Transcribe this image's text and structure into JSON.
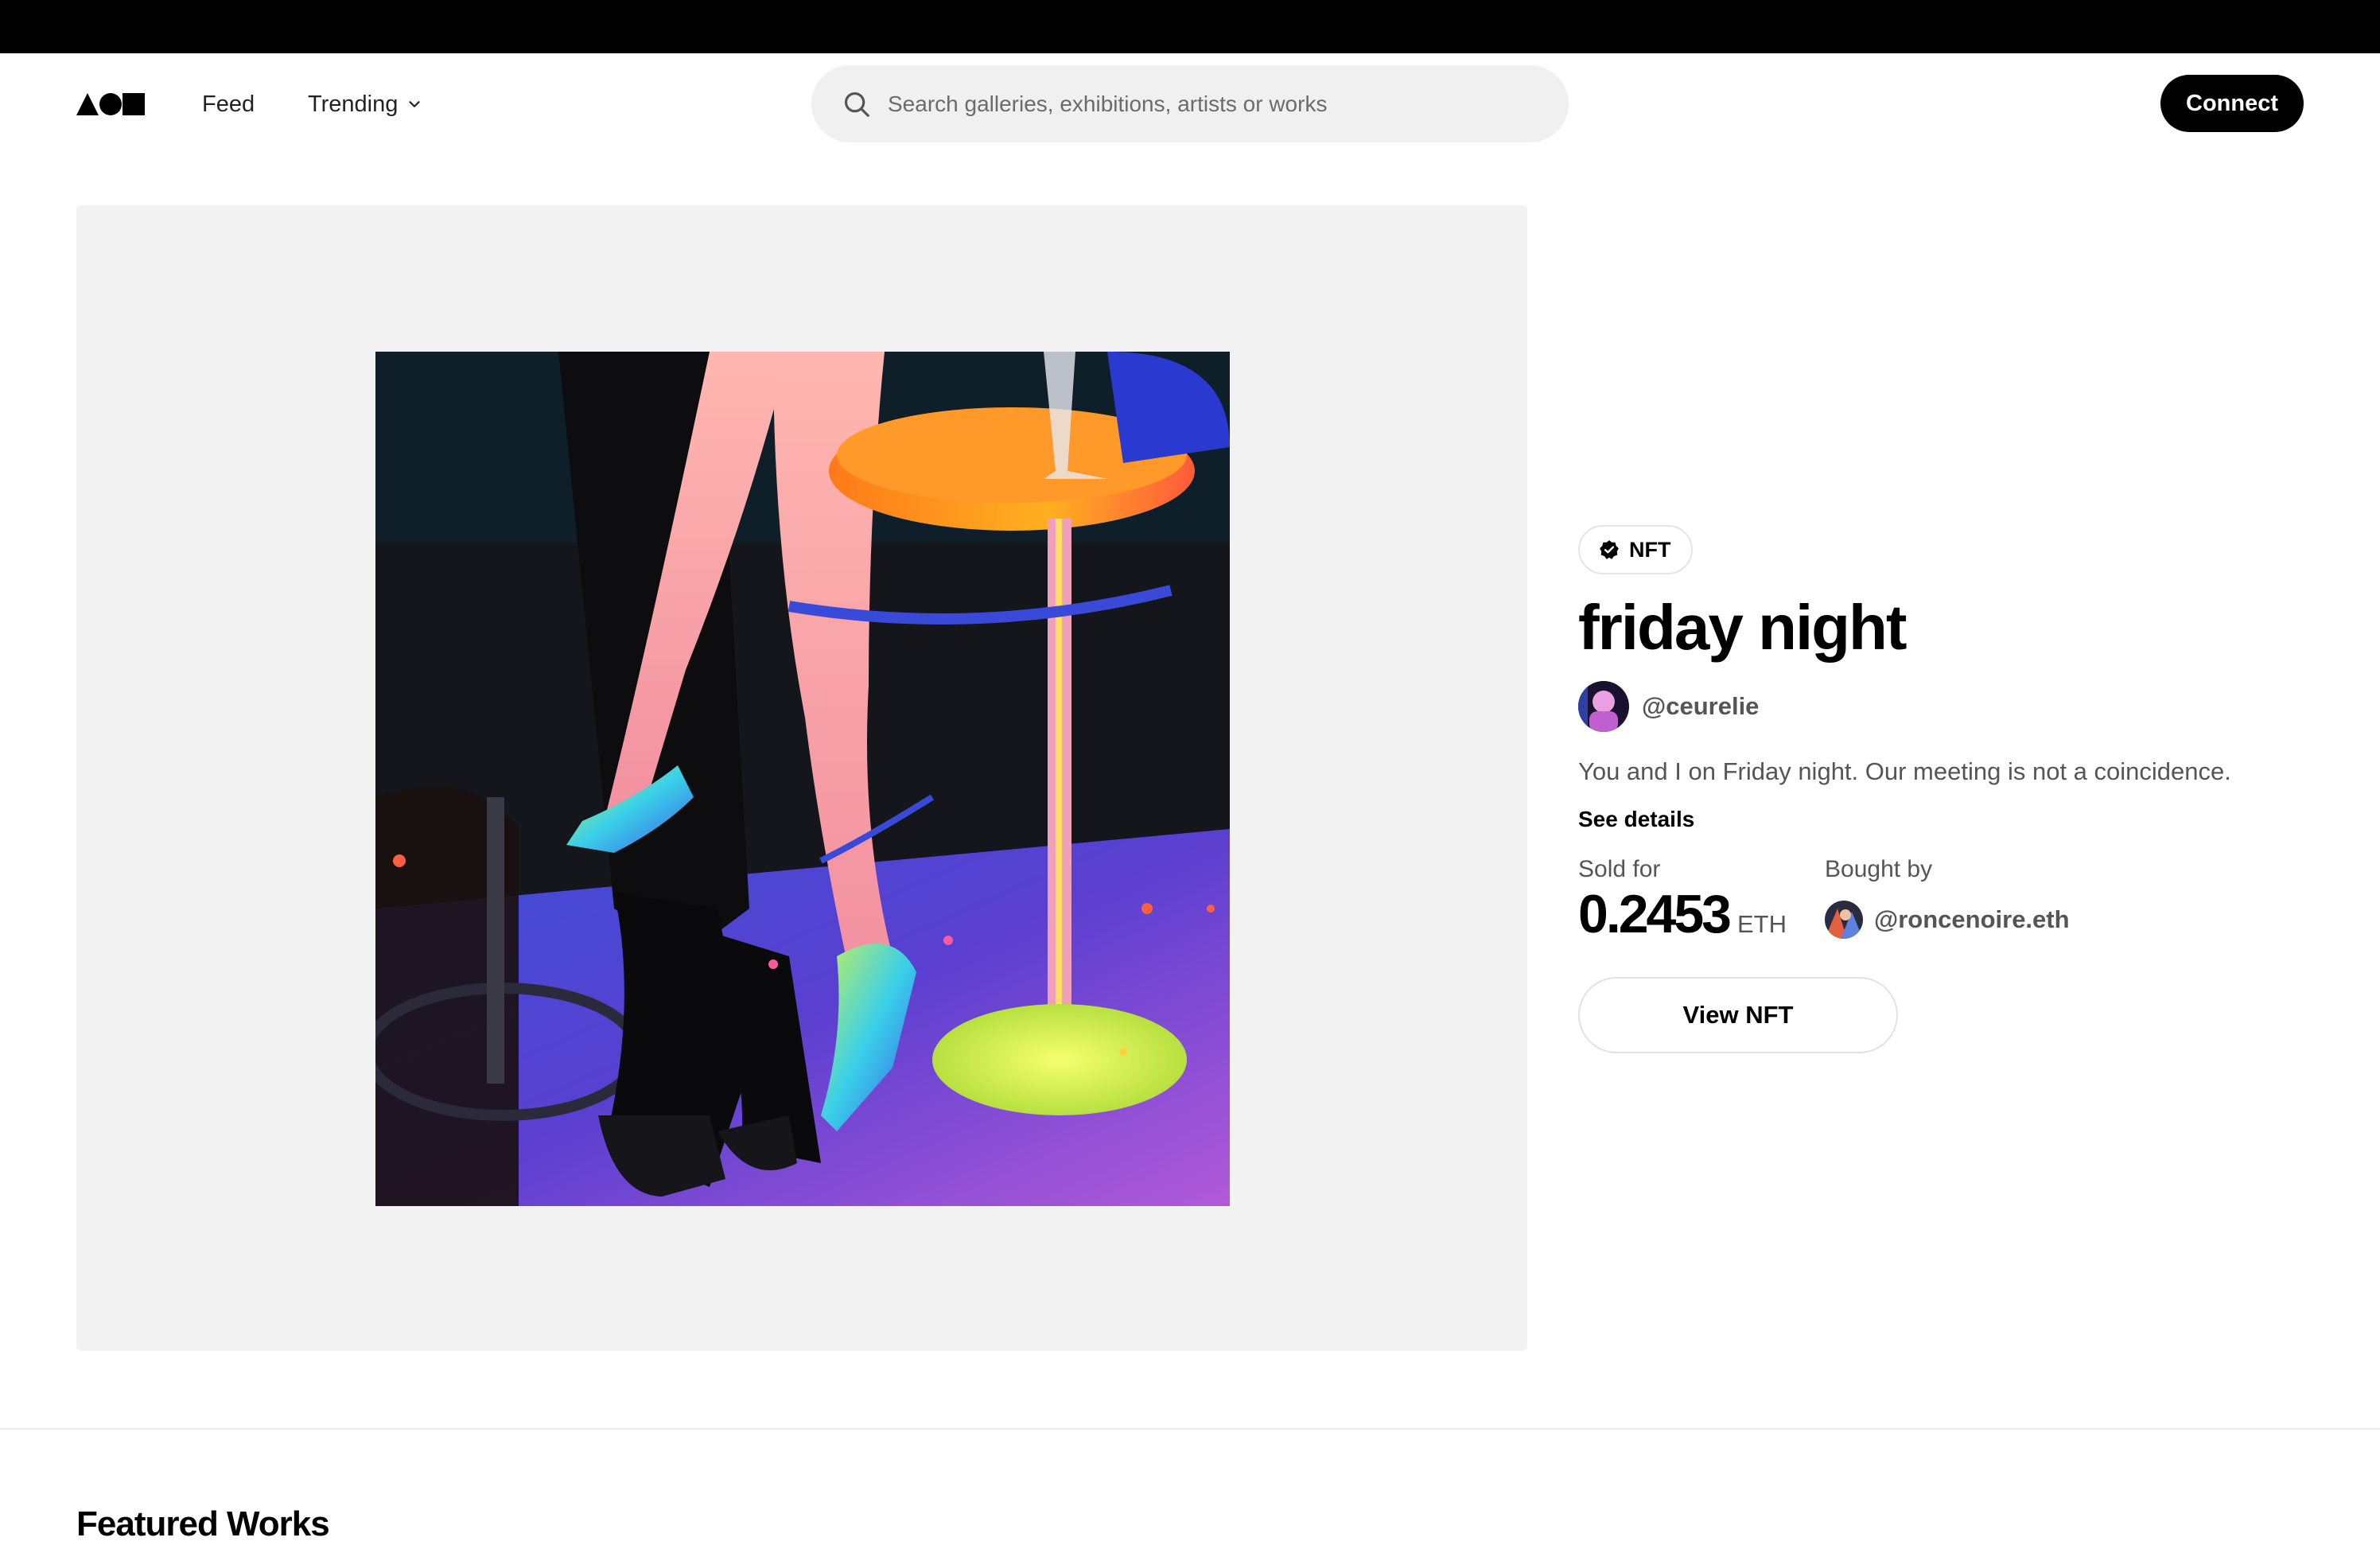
{
  "nav": {
    "feed_label": "Feed",
    "trending_label": "Trending",
    "search_placeholder": "Search galleries, exhibitions, artists or works",
    "connect_label": "Connect"
  },
  "work": {
    "badge": "NFT",
    "title": "friday night",
    "artist_handle": "@ceurelie",
    "description": "You and I on Friday night. Our meeting is not a coincidence.",
    "see_details": "See details",
    "sold_for_label": "Sold for",
    "price": "0.2453",
    "currency": "ETH",
    "bought_by_label": "Bought by",
    "buyer_handle": "@roncenoire.eth",
    "view_button": "View NFT"
  },
  "section": {
    "featured_title": "Featured Works"
  },
  "icons": {
    "logo": "triangle-circle-square-logo",
    "search": "magnifier-icon",
    "chevron": "chevron-down-icon",
    "badge": "verified-badge-icon"
  },
  "colors": {
    "accent": "#000000",
    "panel": "#f2f2f2",
    "muted_text": "#555555"
  }
}
